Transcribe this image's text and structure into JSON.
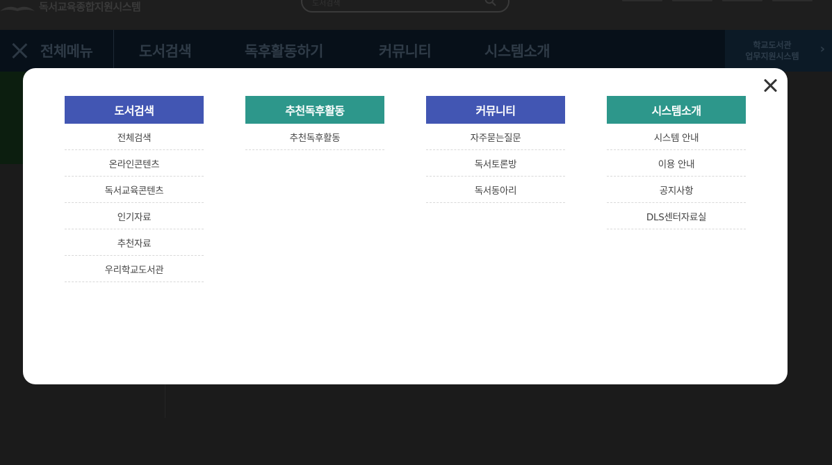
{
  "site": {
    "logo_text": "독서교육종합지원시스템",
    "search_placeholder": "도서검색",
    "gnb": {
      "all_menu_label": "전체메뉴",
      "items": [
        "도서검색",
        "독후활동하기",
        "커뮤니티",
        "시스템소개"
      ],
      "side_link_line1": "학교도서관",
      "side_link_line2": "업무지원시스템"
    }
  },
  "modal": {
    "columns": [
      {
        "title": "도서검색",
        "color": "#4256b3",
        "items": [
          "전체검색",
          "온라인콘텐츠",
          "독서교육콘텐츠",
          "인기자료",
          "추천자료",
          "우리학교도서관"
        ]
      },
      {
        "title": "추천독후활동",
        "color": "#2d978b",
        "items": [
          "추천독후활동"
        ]
      },
      {
        "title": "커뮤니티",
        "color": "#4256b3",
        "items": [
          "자주묻는질문",
          "독서토론방",
          "독서동아리"
        ]
      },
      {
        "title": "시스템소개",
        "color": "#2d978b",
        "items": [
          "시스템 안내",
          "이용 안내",
          "공지사항",
          "DLS센터자료실"
        ]
      }
    ]
  }
}
